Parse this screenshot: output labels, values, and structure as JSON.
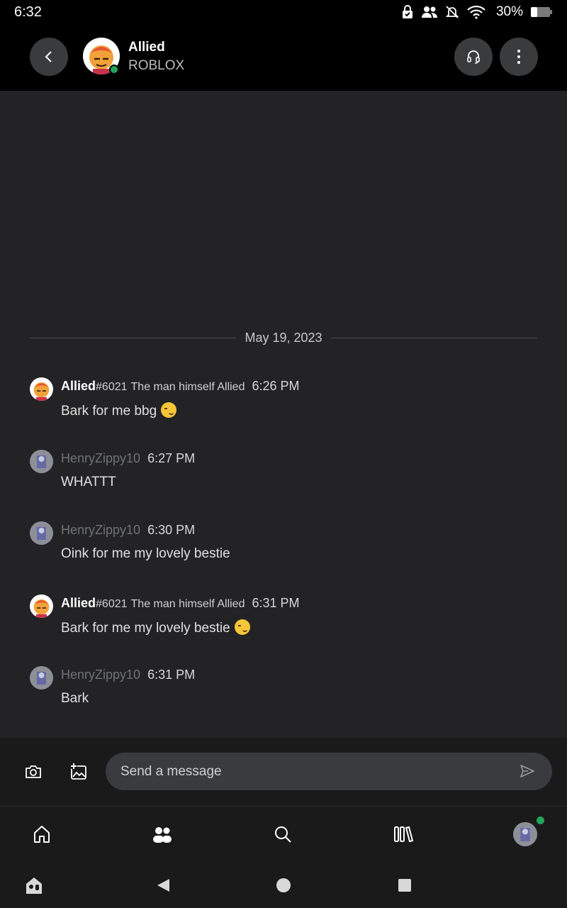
{
  "status_bar": {
    "time": "6:32",
    "battery": "30%",
    "icons": [
      "lock-check-icon",
      "people-icon",
      "bell-off-icon",
      "wifi-icon",
      "battery-icon"
    ]
  },
  "header": {
    "name": "Allied",
    "subtitle": "ROBLOX",
    "online_color": "#22a45a",
    "buttons": [
      "back-icon",
      "headset-icon",
      "more-vertical-icon"
    ]
  },
  "chat": {
    "date": "May 19, 2023",
    "messages": [
      {
        "name": "Allied",
        "tag": "#6021",
        "title": "The man himself Allied",
        "time": "6:26 PM",
        "text": "Bark for me bbg"
      },
      {
        "name": "HenryZippy10",
        "time": "6:27 PM",
        "text": "WHATTT"
      },
      {
        "name": "HenryZippy10",
        "time": "6:30 PM",
        "text": "Oink for me my lovely bestie"
      },
      {
        "name": "Allied",
        "tag": "#6021",
        "title": "The man himself Allied",
        "time": "6:31 PM",
        "text": "Bark for me my lovely bestie"
      },
      {
        "name": "HenryZippy10",
        "time": "6:31 PM",
        "text": "Bark"
      }
    ]
  },
  "composer": {
    "placeholder": "Send a message",
    "icons": [
      "camera-icon",
      "add-image-icon",
      "send-icon"
    ]
  },
  "bottom_nav": {
    "items": [
      "home-icon",
      "friends-icon",
      "search-icon",
      "library-icon",
      "profile-avatar"
    ],
    "active": "friends-icon",
    "badge_color": "#22a45a"
  },
  "system_nav": {
    "buttons": [
      "app-icon",
      "back-triangle-icon",
      "home-circle-icon",
      "recents-square-icon"
    ]
  }
}
